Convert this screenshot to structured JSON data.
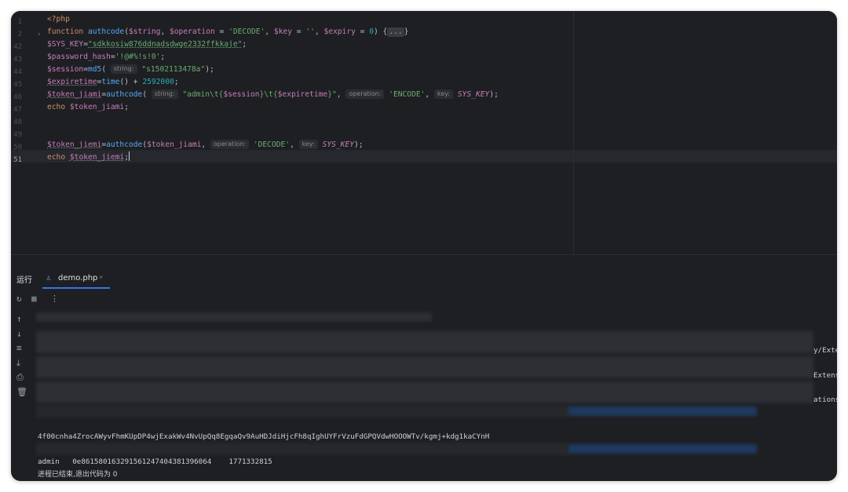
{
  "editor": {
    "line_numbers": [
      "1",
      "2",
      "42",
      "43",
      "44",
      "45",
      "46",
      "47",
      "48",
      "49",
      "50",
      "51"
    ],
    "current_line": "51",
    "lines": {
      "l1": "<?php",
      "l2_kw": "function",
      "l2_fn": "authcode",
      "l2_a": "(",
      "l2_v1": "$string",
      "l2_b": ", ",
      "l2_v2": "$operation",
      "l2_c": " = ",
      "l2_s1": "'DECODE'",
      "l2_d": ", ",
      "l2_v3": "$key",
      "l2_e": " = ",
      "l2_s2": "''",
      "l2_f": ", ",
      "l2_v4": "$expiry",
      "l2_g": " = ",
      "l2_n": "0",
      "l2_h": ") {",
      "l2_collapsed": "...",
      "l2_i": "}",
      "l42_v": "$SYS_KEY",
      "l42_eq": "=",
      "l42_s": "\"sdkkosiw876ddnadsdwge2332ffkkaje\"",
      "l42_end": ";",
      "l43_v": "$password_hash",
      "l43_eq": "=",
      "l43_s": "'!@#%!s!0'",
      "l43_end": ";",
      "l44_v": "$session",
      "l44_eq": "=",
      "l44_fn": "md5",
      "l44_a": "( ",
      "l44_hint": "string:",
      "l44_s": "\"s1502113478a\"",
      "l44_end": ");",
      "l45_v": "$expiretime",
      "l45_eq": "=",
      "l45_fn": "time",
      "l45_a": "() + ",
      "l45_n": "2592000",
      "l45_end": ";",
      "l46_v": "$token_jiami",
      "l46_eq": "=",
      "l46_fn": "authcode",
      "l46_a": "( ",
      "l46_hint1": "string:",
      "l46_s1a": "\"admin\\t{",
      "l46_s1v1": "$session",
      "l46_s1b": "}\\t{",
      "l46_s1v2": "$expiretime",
      "l46_s1c": "}\"",
      "l46_b": ", ",
      "l46_hint2": "operation:",
      "l46_s2": "'ENCODE'",
      "l46_c": ", ",
      "l46_hint3": "key:",
      "l46_k": "SYS_KEY",
      "l46_end": ");",
      "l47_kw": "echo",
      "l47_v": "$token_jiami",
      "l47_end": ";",
      "l50_v": "$token_jiemi",
      "l50_eq": "=",
      "l50_fn": "authcode",
      "l50_a": "(",
      "l50_v2": "$token_jiami",
      "l50_b": ", ",
      "l50_hint1": "operation:",
      "l50_s": "'DECODE'",
      "l50_c": ", ",
      "l50_hint2": "key:",
      "l50_k": "SYS_KEY",
      "l50_end": ");",
      "l51_kw": "echo",
      "l51_v": "$token_jiemi",
      "l51_end": ";"
    }
  },
  "run_panel": {
    "title": "运行",
    "tab_label": "demo.php",
    "tab_close": "×"
  },
  "console": {
    "edge_1": "y/Exte",
    "edge_2": "Extens",
    "edge_3": "ations",
    "token_line": "4f00cnha4ZrocAWyvFhmKUpDP4wjExakWv4NvUpQq8EgqaQv9AuHDJdiHjcFh8qIghUYFrVzuFdGPQVdwHOOOWTv/kgmj+kdg1kaCYnH",
    "decoded_line": "admin   0e861580163291561247404381396064    1771332815",
    "exit_line": "进程已结束,退出代码为 0"
  },
  "icons": {
    "rerun": "rerun-icon",
    "stop": "stop-icon",
    "more": "more-icon",
    "up": "arrow-up-icon",
    "down": "arrow-down-icon",
    "wrap": "soft-wrap-icon",
    "scroll_end": "scroll-to-end-icon",
    "print": "print-icon",
    "trash": "trash-icon"
  },
  "colors": {
    "background": "#1e1f22",
    "keyword": "#cf8e6d",
    "function": "#56a8f5",
    "variable": "#c77dbb",
    "string": "#6aab73",
    "number": "#2aacb8",
    "accent": "#3574f0"
  }
}
